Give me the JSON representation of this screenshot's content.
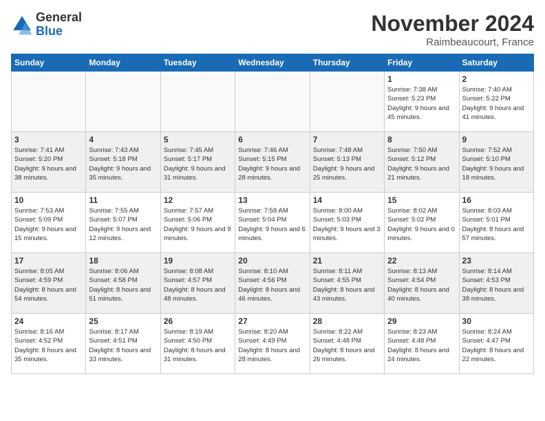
{
  "logo": {
    "general": "General",
    "blue": "Blue"
  },
  "title": "November 2024",
  "location": "Raimbeaucourt, France",
  "days_of_week": [
    "Sunday",
    "Monday",
    "Tuesday",
    "Wednesday",
    "Thursday",
    "Friday",
    "Saturday"
  ],
  "weeks": [
    [
      {
        "day": "",
        "empty": true
      },
      {
        "day": "",
        "empty": true
      },
      {
        "day": "",
        "empty": true
      },
      {
        "day": "",
        "empty": true
      },
      {
        "day": "",
        "empty": true
      },
      {
        "day": "1",
        "sunrise": "7:38 AM",
        "sunset": "5:23 PM",
        "daylight": "9 hours and 45 minutes."
      },
      {
        "day": "2",
        "sunrise": "7:40 AM",
        "sunset": "5:22 PM",
        "daylight": "9 hours and 41 minutes."
      }
    ],
    [
      {
        "day": "3",
        "sunrise": "7:41 AM",
        "sunset": "5:20 PM",
        "daylight": "9 hours and 38 minutes."
      },
      {
        "day": "4",
        "sunrise": "7:43 AM",
        "sunset": "5:18 PM",
        "daylight": "9 hours and 35 minutes."
      },
      {
        "day": "5",
        "sunrise": "7:45 AM",
        "sunset": "5:17 PM",
        "daylight": "9 hours and 31 minutes."
      },
      {
        "day": "6",
        "sunrise": "7:46 AM",
        "sunset": "5:15 PM",
        "daylight": "9 hours and 28 minutes."
      },
      {
        "day": "7",
        "sunrise": "7:48 AM",
        "sunset": "5:13 PM",
        "daylight": "9 hours and 25 minutes."
      },
      {
        "day": "8",
        "sunrise": "7:50 AM",
        "sunset": "5:12 PM",
        "daylight": "9 hours and 21 minutes."
      },
      {
        "day": "9",
        "sunrise": "7:52 AM",
        "sunset": "5:10 PM",
        "daylight": "9 hours and 18 minutes."
      }
    ],
    [
      {
        "day": "10",
        "sunrise": "7:53 AM",
        "sunset": "5:09 PM",
        "daylight": "9 hours and 15 minutes."
      },
      {
        "day": "11",
        "sunrise": "7:55 AM",
        "sunset": "5:07 PM",
        "daylight": "9 hours and 12 minutes."
      },
      {
        "day": "12",
        "sunrise": "7:57 AM",
        "sunset": "5:06 PM",
        "daylight": "9 hours and 9 minutes."
      },
      {
        "day": "13",
        "sunrise": "7:58 AM",
        "sunset": "5:04 PM",
        "daylight": "9 hours and 6 minutes."
      },
      {
        "day": "14",
        "sunrise": "8:00 AM",
        "sunset": "5:03 PM",
        "daylight": "9 hours and 3 minutes."
      },
      {
        "day": "15",
        "sunrise": "8:02 AM",
        "sunset": "5:02 PM",
        "daylight": "9 hours and 0 minutes."
      },
      {
        "day": "16",
        "sunrise": "8:03 AM",
        "sunset": "5:01 PM",
        "daylight": "8 hours and 57 minutes."
      }
    ],
    [
      {
        "day": "17",
        "sunrise": "8:05 AM",
        "sunset": "4:59 PM",
        "daylight": "8 hours and 54 minutes."
      },
      {
        "day": "18",
        "sunrise": "8:06 AM",
        "sunset": "4:58 PM",
        "daylight": "8 hours and 51 minutes."
      },
      {
        "day": "19",
        "sunrise": "8:08 AM",
        "sunset": "4:57 PM",
        "daylight": "8 hours and 48 minutes."
      },
      {
        "day": "20",
        "sunrise": "8:10 AM",
        "sunset": "4:56 PM",
        "daylight": "8 hours and 46 minutes."
      },
      {
        "day": "21",
        "sunrise": "8:11 AM",
        "sunset": "4:55 PM",
        "daylight": "8 hours and 43 minutes."
      },
      {
        "day": "22",
        "sunrise": "8:13 AM",
        "sunset": "4:54 PM",
        "daylight": "8 hours and 40 minutes."
      },
      {
        "day": "23",
        "sunrise": "8:14 AM",
        "sunset": "4:53 PM",
        "daylight": "8 hours and 38 minutes."
      }
    ],
    [
      {
        "day": "24",
        "sunrise": "8:16 AM",
        "sunset": "4:52 PM",
        "daylight": "8 hours and 35 minutes."
      },
      {
        "day": "25",
        "sunrise": "8:17 AM",
        "sunset": "4:51 PM",
        "daylight": "8 hours and 33 minutes."
      },
      {
        "day": "26",
        "sunrise": "8:19 AM",
        "sunset": "4:50 PM",
        "daylight": "8 hours and 31 minutes."
      },
      {
        "day": "27",
        "sunrise": "8:20 AM",
        "sunset": "4:49 PM",
        "daylight": "8 hours and 28 minutes."
      },
      {
        "day": "28",
        "sunrise": "8:22 AM",
        "sunset": "4:48 PM",
        "daylight": "8 hours and 26 minutes."
      },
      {
        "day": "29",
        "sunrise": "8:23 AM",
        "sunset": "4:48 PM",
        "daylight": "8 hours and 24 minutes."
      },
      {
        "day": "30",
        "sunrise": "8:24 AM",
        "sunset": "4:47 PM",
        "daylight": "8 hours and 22 minutes."
      }
    ]
  ]
}
